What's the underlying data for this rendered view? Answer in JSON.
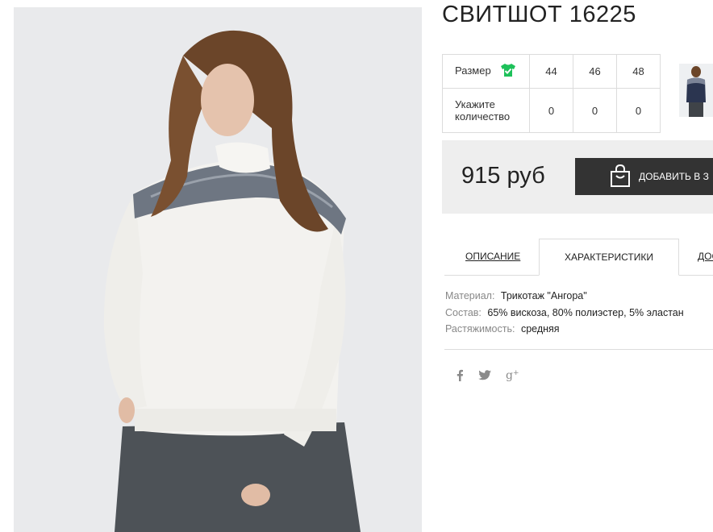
{
  "product": {
    "title": "СВИТШОТ 16225"
  },
  "sizes": {
    "size_label": "Размер",
    "qty_label": "Укажите количество",
    "columns": [
      "44",
      "46",
      "48"
    ],
    "quantities": [
      "0",
      "0",
      "0"
    ]
  },
  "buy": {
    "price": "915 руб",
    "add_label": "ДОБАВИТЬ В З"
  },
  "tabs": [
    "ОПИСАНИЕ",
    "ХАРАКТЕРИСТИКИ",
    "ДОС"
  ],
  "properties": [
    {
      "key": "Материал:",
      "value": "Трикотаж \"Ангора\""
    },
    {
      "key": "Состав:",
      "value": "65% вискоза, 80% полиэстер, 5% эластан"
    },
    {
      "key": "Растяжимость:",
      "value": "средняя"
    }
  ],
  "social": [
    {
      "icon": "facebook-icon",
      "glyph": "f"
    },
    {
      "icon": "twitter-icon",
      "glyph": "🐦"
    },
    {
      "icon": "google-plus-icon",
      "glyph": "g+"
    }
  ],
  "colors": {
    "button": "#333333",
    "buybox": "#eeeeee",
    "size_check": "#1ec15a"
  }
}
